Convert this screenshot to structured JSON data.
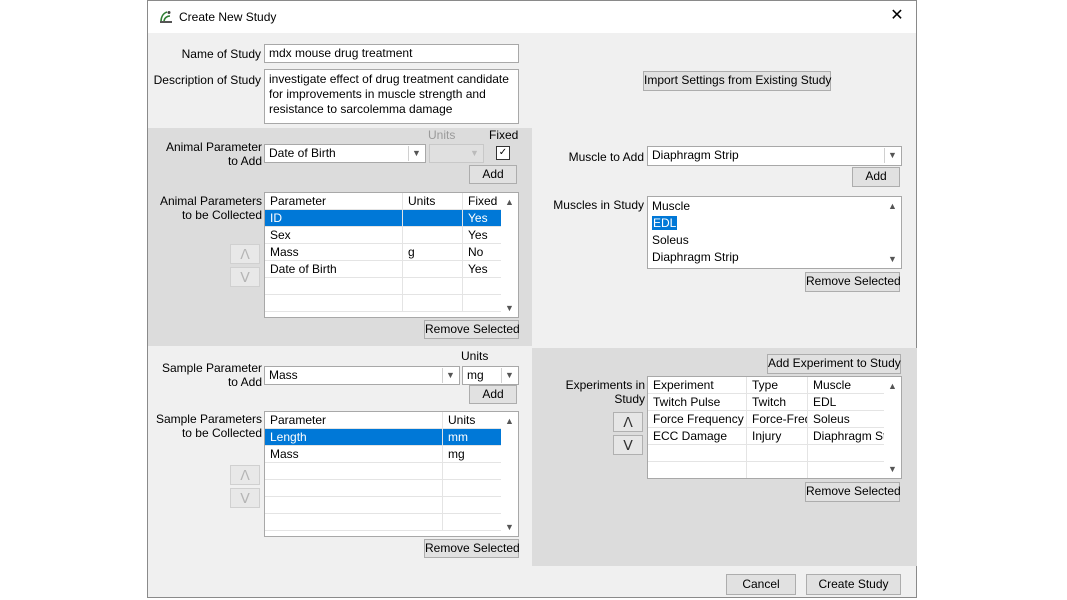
{
  "window": {
    "title": "Create New Study",
    "close_symbol": "✕"
  },
  "study": {
    "name_label": "Name of Study",
    "name_value": "mdx mouse drug treatment",
    "desc_label": "Description of Study",
    "desc_lines": [
      "investigate effect of drug treatment candidate",
      "for improvements in muscle strength and",
      "resistance to sarcolemma damage"
    ]
  },
  "import_button": "Import Settings from Existing Study",
  "animal": {
    "add_label_1": "Animal Parameter",
    "add_label_2": "to Add",
    "units_header": "Units",
    "fixed_header": "Fixed",
    "selected_param": "Date of Birth",
    "fixed_checked": "✓",
    "add_button": "Add",
    "collected_label_1": "Animal Parameters",
    "collected_label_2": "to be Collected",
    "columns": [
      "Parameter",
      "Units",
      "Fixed"
    ],
    "rows": [
      [
        "ID",
        "",
        "Yes"
      ],
      [
        "Sex",
        "",
        "Yes"
      ],
      [
        "Mass",
        "g",
        "No"
      ],
      [
        "Date of Birth",
        "",
        "Yes"
      ]
    ],
    "remove_button": "Remove Selected"
  },
  "sample": {
    "units_header": "Units",
    "add_label_1": "Sample Parameter",
    "add_label_2": "to Add",
    "selected_param": "Mass",
    "selected_units": "mg",
    "add_button": "Add",
    "collected_label_1": "Sample Parameters",
    "collected_label_2": "to be Collected",
    "columns": [
      "Parameter",
      "Units"
    ],
    "rows": [
      [
        "Length",
        "mm"
      ],
      [
        "Mass",
        "mg"
      ]
    ],
    "remove_button": "Remove Selected"
  },
  "muscle": {
    "add_label": "Muscle to Add",
    "selected": "Diaphragm Strip",
    "add_button": "Add",
    "list_label": "Muscles in Study",
    "items": [
      "Muscle",
      "EDL",
      "Soleus",
      "Diaphragm Strip"
    ],
    "remove_button": "Remove Selected"
  },
  "experiments": {
    "add_button": "Add Experiment to Study",
    "label": "Experiments in Study",
    "columns": [
      "Experiment",
      "Type",
      "Muscle"
    ],
    "rows": [
      [
        "Twitch Pulse",
        "Twitch",
        "EDL"
      ],
      [
        "Force Frequency",
        "Force-Freq",
        "Soleus"
      ],
      [
        "ECC Damage",
        "Injury",
        "Diaphragm St"
      ]
    ],
    "remove_button": "Remove Selected"
  },
  "icons": {
    "up": "ᐱ",
    "down": "ᐯ",
    "scroll_up": "▲",
    "scroll_down": "▼",
    "combo": "▼"
  },
  "footer": {
    "cancel": "Cancel",
    "create": "Create Study"
  }
}
